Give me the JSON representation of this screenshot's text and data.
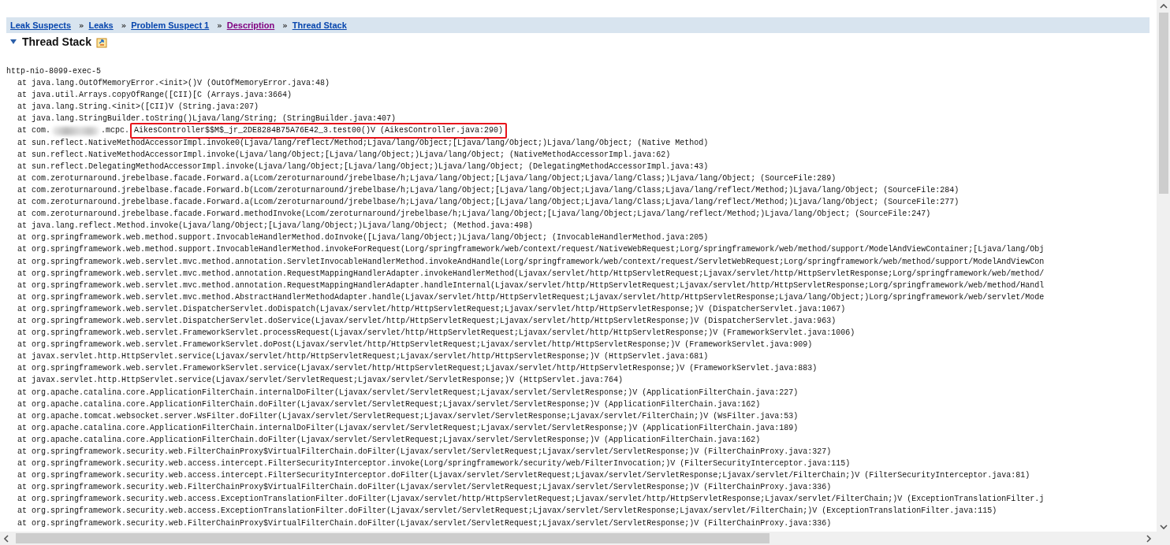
{
  "breadcrumbs": [
    {
      "label": "Leak Suspects",
      "visited": false
    },
    {
      "separator": "»",
      "label": "Leaks",
      "visited": false
    },
    {
      "separator": "»",
      "label": "Problem Suspect 1",
      "visited": false
    },
    {
      "separator": "»",
      "label": "Description",
      "visited": true
    },
    {
      "separator": "»",
      "label": "Thread Stack",
      "visited": false
    }
  ],
  "section": {
    "title": "Thread Stack",
    "expanded": true
  },
  "thread": "http-nio-8099-exec-5",
  "frames": [
    {
      "kind": "plain",
      "text": "at java.lang.OutOfMemoryError.<init>()V (OutOfMemoryError.java:48)"
    },
    {
      "kind": "plain",
      "text": "at java.util.Arrays.copyOfRange([CII)[C (Arrays.java:3664)"
    },
    {
      "kind": "plain",
      "text": "at java.lang.String.<init>([CII)V (String.java:207)"
    },
    {
      "kind": "plain",
      "text": "at java.lang.StringBuilder.toString()Ljava/lang/String; (StringBuilder.java:407)"
    },
    {
      "kind": "redacted",
      "prefix": "at com.",
      "suffix": ".mcpc.",
      "highlight": "AikesController$$M$_jr_2DE8284B75A76E42_3.test00()V (AikesController.java:290)"
    },
    {
      "kind": "plain",
      "text": "at sun.reflect.NativeMethodAccessorImpl.invoke0(Ljava/lang/reflect/Method;Ljava/lang/Object;[Ljava/lang/Object;)Ljava/lang/Object; (Native Method)"
    },
    {
      "kind": "plain",
      "text": "at sun.reflect.NativeMethodAccessorImpl.invoke(Ljava/lang/Object;[Ljava/lang/Object;)Ljava/lang/Object; (NativeMethodAccessorImpl.java:62)"
    },
    {
      "kind": "plain",
      "text": "at sun.reflect.DelegatingMethodAccessorImpl.invoke(Ljava/lang/Object;[Ljava/lang/Object;)Ljava/lang/Object; (DelegatingMethodAccessorImpl.java:43)"
    },
    {
      "kind": "plain",
      "text": "at com.zeroturnaround.jrebelbase.facade.Forward.a(Lcom/zeroturnaround/jrebelbase/h;Ljava/lang/Object;[Ljava/lang/Object;Ljava/lang/Class;)Ljava/lang/Object; (SourceFile:289)"
    },
    {
      "kind": "plain",
      "text": "at com.zeroturnaround.jrebelbase.facade.Forward.b(Lcom/zeroturnaround/jrebelbase/h;Ljava/lang/Object;[Ljava/lang/Object;Ljava/lang/Class;Ljava/lang/reflect/Method;)Ljava/lang/Object; (SourceFile:284)"
    },
    {
      "kind": "plain",
      "text": "at com.zeroturnaround.jrebelbase.facade.Forward.a(Lcom/zeroturnaround/jrebelbase/h;Ljava/lang/Object;[Ljava/lang/Object;Ljava/lang/Class;Ljava/lang/reflect/Method;)Ljava/lang/Object; (SourceFile:277)"
    },
    {
      "kind": "plain",
      "text": "at com.zeroturnaround.jrebelbase.facade.Forward.methodInvoke(Lcom/zeroturnaround/jrebelbase/h;Ljava/lang/Object;[Ljava/lang/Object;Ljava/lang/reflect/Method;)Ljava/lang/Object; (SourceFile:247)"
    },
    {
      "kind": "plain",
      "text": "at java.lang.reflect.Method.invoke(Ljava/lang/Object;[Ljava/lang/Object;)Ljava/lang/Object; (Method.java:498)"
    },
    {
      "kind": "plain",
      "text": "at org.springframework.web.method.support.InvocableHandlerMethod.doInvoke([Ljava/lang/Object;)Ljava/lang/Object; (InvocableHandlerMethod.java:205)"
    },
    {
      "kind": "plain",
      "text": "at org.springframework.web.method.support.InvocableHandlerMethod.invokeForRequest(Lorg/springframework/web/context/request/NativeWebRequest;Lorg/springframework/web/method/support/ModelAndViewContainer;[Ljava/lang/Obj"
    },
    {
      "kind": "plain",
      "text": "at org.springframework.web.servlet.mvc.method.annotation.ServletInvocableHandlerMethod.invokeAndHandle(Lorg/springframework/web/context/request/ServletWebRequest;Lorg/springframework/web/method/support/ModelAndViewCon"
    },
    {
      "kind": "plain",
      "text": "at org.springframework.web.servlet.mvc.method.annotation.RequestMappingHandlerAdapter.invokeHandlerMethod(Ljavax/servlet/http/HttpServletRequest;Ljavax/servlet/http/HttpServletResponse;Lorg/springframework/web/method/"
    },
    {
      "kind": "plain",
      "text": "at org.springframework.web.servlet.mvc.method.annotation.RequestMappingHandlerAdapter.handleInternal(Ljavax/servlet/http/HttpServletRequest;Ljavax/servlet/http/HttpServletResponse;Lorg/springframework/web/method/Handl"
    },
    {
      "kind": "plain",
      "text": "at org.springframework.web.servlet.mvc.method.AbstractHandlerMethodAdapter.handle(Ljavax/servlet/http/HttpServletRequest;Ljavax/servlet/http/HttpServletResponse;Ljava/lang/Object;)Lorg/springframework/web/servlet/Mode"
    },
    {
      "kind": "plain",
      "text": "at org.springframework.web.servlet.DispatcherServlet.doDispatch(Ljavax/servlet/http/HttpServletRequest;Ljavax/servlet/http/HttpServletResponse;)V (DispatcherServlet.java:1067)"
    },
    {
      "kind": "plain",
      "text": "at org.springframework.web.servlet.DispatcherServlet.doService(Ljavax/servlet/http/HttpServletRequest;Ljavax/servlet/http/HttpServletResponse;)V (DispatcherServlet.java:963)"
    },
    {
      "kind": "plain",
      "text": "at org.springframework.web.servlet.FrameworkServlet.processRequest(Ljavax/servlet/http/HttpServletRequest;Ljavax/servlet/http/HttpServletResponse;)V (FrameworkServlet.java:1006)"
    },
    {
      "kind": "plain",
      "text": "at org.springframework.web.servlet.FrameworkServlet.doPost(Ljavax/servlet/http/HttpServletRequest;Ljavax/servlet/http/HttpServletResponse;)V (FrameworkServlet.java:909)"
    },
    {
      "kind": "plain",
      "text": "at javax.servlet.http.HttpServlet.service(Ljavax/servlet/http/HttpServletRequest;Ljavax/servlet/http/HttpServletResponse;)V (HttpServlet.java:681)"
    },
    {
      "kind": "plain",
      "text": "at org.springframework.web.servlet.FrameworkServlet.service(Ljavax/servlet/http/HttpServletRequest;Ljavax/servlet/http/HttpServletResponse;)V (FrameworkServlet.java:883)"
    },
    {
      "kind": "plain",
      "text": "at javax.servlet.http.HttpServlet.service(Ljavax/servlet/ServletRequest;Ljavax/servlet/ServletResponse;)V (HttpServlet.java:764)"
    },
    {
      "kind": "plain",
      "text": "at org.apache.catalina.core.ApplicationFilterChain.internalDoFilter(Ljavax/servlet/ServletRequest;Ljavax/servlet/ServletResponse;)V (ApplicationFilterChain.java:227)"
    },
    {
      "kind": "plain",
      "text": "at org.apache.catalina.core.ApplicationFilterChain.doFilter(Ljavax/servlet/ServletRequest;Ljavax/servlet/ServletResponse;)V (ApplicationFilterChain.java:162)"
    },
    {
      "kind": "plain",
      "text": "at org.apache.tomcat.websocket.server.WsFilter.doFilter(Ljavax/servlet/ServletRequest;Ljavax/servlet/ServletResponse;Ljavax/servlet/FilterChain;)V (WsFilter.java:53)"
    },
    {
      "kind": "plain",
      "text": "at org.apache.catalina.core.ApplicationFilterChain.internalDoFilter(Ljavax/servlet/ServletRequest;Ljavax/servlet/ServletResponse;)V (ApplicationFilterChain.java:189)"
    },
    {
      "kind": "plain",
      "text": "at org.apache.catalina.core.ApplicationFilterChain.doFilter(Ljavax/servlet/ServletRequest;Ljavax/servlet/ServletResponse;)V (ApplicationFilterChain.java:162)"
    },
    {
      "kind": "plain",
      "text": "at org.springframework.security.web.FilterChainProxy$VirtualFilterChain.doFilter(Ljavax/servlet/ServletRequest;Ljavax/servlet/ServletResponse;)V (FilterChainProxy.java:327)"
    },
    {
      "kind": "plain",
      "text": "at org.springframework.security.web.access.intercept.FilterSecurityInterceptor.invoke(Lorg/springframework/security/web/FilterInvocation;)V (FilterSecurityInterceptor.java:115)"
    },
    {
      "kind": "plain",
      "text": "at org.springframework.security.web.access.intercept.FilterSecurityInterceptor.doFilter(Ljavax/servlet/ServletRequest;Ljavax/servlet/ServletResponse;Ljavax/servlet/FilterChain;)V (FilterSecurityInterceptor.java:81)"
    },
    {
      "kind": "plain",
      "text": "at org.springframework.security.web.FilterChainProxy$VirtualFilterChain.doFilter(Ljavax/servlet/ServletRequest;Ljavax/servlet/ServletResponse;)V (FilterChainProxy.java:336)"
    },
    {
      "kind": "plain",
      "text": "at org.springframework.security.web.access.ExceptionTranslationFilter.doFilter(Ljavax/servlet/http/HttpServletRequest;Ljavax/servlet/http/HttpServletResponse;Ljavax/servlet/FilterChain;)V (ExceptionTranslationFilter.j"
    },
    {
      "kind": "plain",
      "text": "at org.springframework.security.web.access.ExceptionTranslationFilter.doFilter(Ljavax/servlet/ServletRequest;Ljavax/servlet/ServletResponse;Ljavax/servlet/FilterChain;)V (ExceptionTranslationFilter.java:115)"
    },
    {
      "kind": "plain",
      "text": "at org.springframework.security.web.FilterChainProxy$VirtualFilterChain.doFilter(Ljavax/servlet/ServletRequest;Ljavax/servlet/ServletResponse;)V (FilterChainProxy.java:336)"
    }
  ]
}
